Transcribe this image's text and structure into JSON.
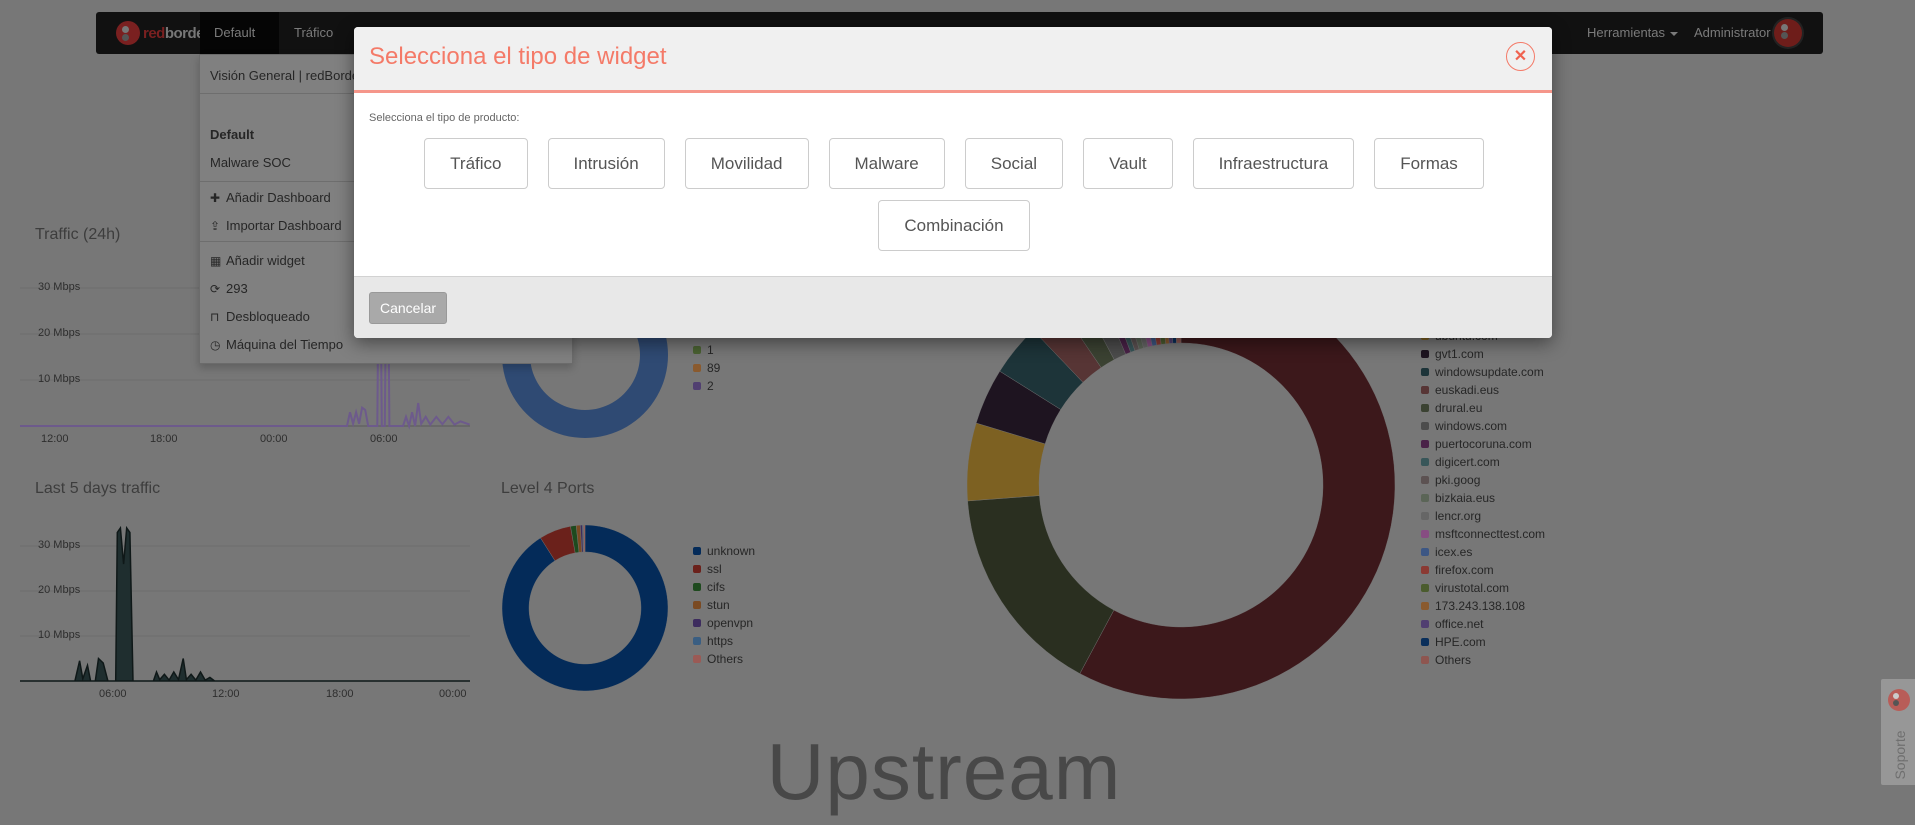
{
  "navbar": {
    "logo_text_a": "red",
    "logo_text_b": "border",
    "dashboard": "Default",
    "trafico": "Tráfico",
    "tools": "Herramientas",
    "user": "Administrator"
  },
  "dashboard_menu": {
    "current": "Visión General | redBorder",
    "dashboards": [
      "Default",
      "Malware SOC"
    ],
    "add_dashboard": "Añadir Dashboard",
    "import_dashboard": "Importar Dashboard",
    "add_widget": "Añadir widget",
    "refresh": "293",
    "lock": "Desbloqueado",
    "time_machine": "Máquina del Tiempo"
  },
  "widgets": {
    "traffic24": {
      "title": "Traffic (24h)",
      "y_ticks": [
        "30 Mbps",
        "20 Mbps",
        "10 Mbps"
      ],
      "x_ticks": [
        "12:00",
        "18:00",
        "00:00",
        "06:00"
      ],
      "color": "#6d5a8c",
      "series": [
        [
          "10:05",
          0
        ],
        [
          "04:05",
          0
        ],
        [
          "04:15",
          3
        ],
        [
          "04:25",
          0.5
        ],
        [
          "04:35",
          3
        ],
        [
          "04:45",
          0.5
        ],
        [
          "04:55",
          4
        ],
        [
          "05:05",
          3.5
        ],
        [
          "05:15",
          0
        ],
        [
          "05:45",
          0
        ],
        [
          "05:50",
          40
        ],
        [
          "05:55",
          40
        ],
        [
          "06:00",
          0
        ],
        [
          "06:10",
          0
        ],
        [
          "06:15",
          40
        ],
        [
          "06:20",
          40
        ],
        [
          "06:25",
          0
        ],
        [
          "07:10",
          0
        ],
        [
          "07:20",
          2
        ],
        [
          "07:30",
          0
        ],
        [
          "07:40",
          3
        ],
        [
          "07:50",
          0
        ],
        [
          "08:00",
          5
        ],
        [
          "08:10",
          0.5
        ],
        [
          "08:25",
          2
        ],
        [
          "08:40",
          0.3
        ],
        [
          "09:00",
          2
        ],
        [
          "09:20",
          0.4
        ],
        [
          "09:40",
          2
        ],
        [
          "10:00",
          0.3
        ],
        [
          "10:20",
          1
        ],
        [
          "10:50",
          0.3
        ]
      ]
    },
    "last5days": {
      "title": "Last 5 days traffic",
      "y_ticks": [
        "30 Mbps",
        "20 Mbps",
        "10 Mbps"
      ],
      "x_ticks": [
        "06:00",
        "12:00",
        "18:00",
        "00:00"
      ],
      "color": "#1f2e2f",
      "series": [
        [
          "01:05",
          0
        ],
        [
          "04:00",
          0
        ],
        [
          "04:15",
          4.5
        ],
        [
          "04:25",
          0.5
        ],
        [
          "04:40",
          3.5
        ],
        [
          "04:50",
          0
        ],
        [
          "05:05",
          0
        ],
        [
          "05:15",
          5
        ],
        [
          "05:30",
          4
        ],
        [
          "05:45",
          0
        ],
        [
          "06:10",
          0
        ],
        [
          "06:15",
          33
        ],
        [
          "06:25",
          34
        ],
        [
          "06:35",
          26
        ],
        [
          "06:45",
          34
        ],
        [
          "06:55",
          33
        ],
        [
          "07:05",
          0
        ],
        [
          "08:10",
          0
        ],
        [
          "08:20",
          2
        ],
        [
          "08:30",
          0.3
        ],
        [
          "08:45",
          1.5
        ],
        [
          "09:00",
          0.2
        ],
        [
          "09:15",
          2
        ],
        [
          "09:30",
          0.3
        ],
        [
          "09:45",
          5
        ],
        [
          "09:55",
          0.3
        ],
        [
          "10:10",
          1.5
        ],
        [
          "10:25",
          0.2
        ],
        [
          "10:40",
          2
        ],
        [
          "10:55",
          0.2
        ],
        [
          "11:10",
          0.8
        ],
        [
          "11:25",
          0
        ],
        [
          "00:55",
          0
        ]
      ]
    },
    "top_donut": {
      "legend": [
        {
          "label": "1",
          "color": "#4a6232"
        },
        {
          "label": "89",
          "color": "#8a5a2e"
        },
        {
          "label": "2",
          "color": "#513f71"
        }
      ],
      "color": "#2f4a73"
    },
    "l4ports": {
      "title": "Level 4 Ports",
      "slices": [
        {
          "label": "unknown",
          "value": 91,
          "color": "#042b59"
        },
        {
          "label": "ssl",
          "value": 6.2,
          "color": "#6b211b"
        },
        {
          "label": "cifs",
          "value": 1.1,
          "color": "#1e4a1e"
        },
        {
          "label": "stun",
          "value": 0.8,
          "color": "#7a4a22"
        },
        {
          "label": "openvpn",
          "value": 0.4,
          "color": "#3d2c5e"
        },
        {
          "label": "https",
          "value": 0.2,
          "color": "#3a5e82"
        },
        {
          "label": "Others",
          "value": 0.3,
          "color": "#9b5a55"
        }
      ]
    },
    "domains": {
      "slices": [
        {
          "value": 57.2,
          "color": "#3c181b"
        },
        {
          "value": 15.8,
          "color": "#2a2f20"
        },
        {
          "label": "ubuntu.com",
          "value": 5.8,
          "color": "#7d6122"
        },
        {
          "label": "gvt1.com",
          "value": 4.2,
          "color": "#1e1420"
        },
        {
          "label": "windowsupdate.com",
          "value": 3.9,
          "color": "#1d3439"
        },
        {
          "label": "euskadi.eus",
          "value": 2.6,
          "color": "#573535"
        },
        {
          "label": "drural.eu",
          "value": 1.7,
          "color": "#3b4232"
        },
        {
          "label": "windows.com",
          "value": 1.4,
          "color": "#4c4c4c"
        },
        {
          "label": "puertocoruna.com",
          "value": 0.6,
          "color": "#4a2248"
        },
        {
          "label": "digicert.com",
          "value": 0.5,
          "color": "#385659"
        },
        {
          "label": "pki.goog",
          "value": 0.5,
          "color": "#5c5252"
        },
        {
          "label": "bizkaia.eus",
          "value": 0.5,
          "color": "#5b6557"
        },
        {
          "label": "lencr.org",
          "value": 0.5,
          "color": "#666666"
        },
        {
          "label": "msftconnecttest.com",
          "value": 0.5,
          "color": "#874d82"
        },
        {
          "label": "icex.es",
          "value": 0.5,
          "color": "#3d5784"
        },
        {
          "label": "firefox.com",
          "value": 0.5,
          "color": "#8b3a33"
        },
        {
          "label": "virustotal.com",
          "value": 0.5,
          "color": "#4b5c2e"
        },
        {
          "label": "173.243.138.108",
          "value": 0.4,
          "color": "#8a5a2e"
        },
        {
          "label": "office.net",
          "value": 0.4,
          "color": "#513f71"
        },
        {
          "label": "HPE.com",
          "value": 0.4,
          "color": "#0a2f5b"
        },
        {
          "label": "Others",
          "value": 0.5,
          "color": "#8e5650"
        }
      ]
    },
    "upstream": "Upstream"
  },
  "support": "Soporte",
  "modal": {
    "title": "Selecciona el tipo de widget",
    "subtitle": "Selecciona el tipo de producto:",
    "types": [
      "Tráfico",
      "Intrusión",
      "Movilidad",
      "Malware",
      "Social",
      "Vault",
      "Infraestructura",
      "Formas",
      "Combinación"
    ],
    "cancel": "Cancelar",
    "accent": "#f47a68"
  }
}
